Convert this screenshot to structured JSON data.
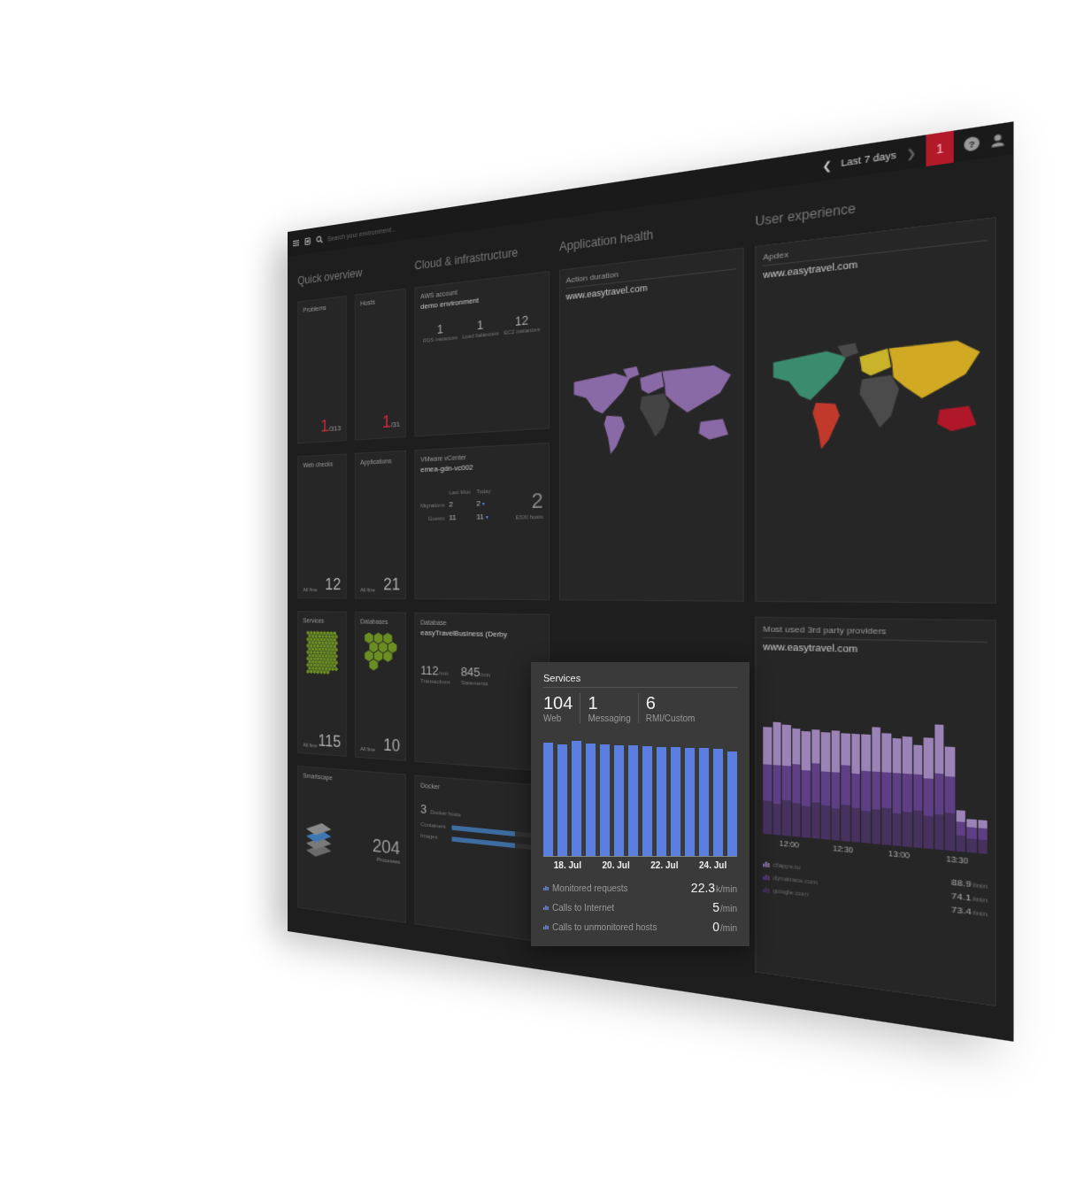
{
  "header": {
    "search_placeholder": "Search your environment...",
    "prev": "❮",
    "timeframe": "Last 7 days",
    "next": "❯",
    "problems_badge": "1",
    "help": "?"
  },
  "quick_overview": {
    "title": "Quick overview",
    "tiles": [
      {
        "kind": "ratio",
        "label": "Problems",
        "value": "1",
        "total": "/313"
      },
      {
        "kind": "ratio",
        "label": "Hosts",
        "value": "1",
        "total": "/31"
      },
      {
        "kind": "count",
        "label": "Web checks",
        "status": "All fine",
        "value": "12"
      },
      {
        "kind": "count",
        "label": "Applications",
        "status": "All fine",
        "value": "21"
      },
      {
        "kind": "hex",
        "label": "Services",
        "status": "All fine",
        "value": "115"
      },
      {
        "kind": "hex",
        "label": "Databases",
        "status": "All fine",
        "value": "10"
      }
    ],
    "smartscape": {
      "label": "Smartscape",
      "value": "204",
      "caption": "Processes"
    }
  },
  "cloud": {
    "title": "Cloud & infrastructure",
    "aws": {
      "label": "AWS account",
      "name": "demo environment",
      "stats": [
        {
          "value": "1",
          "label": "RDS instances"
        },
        {
          "value": "1",
          "label": "Load balancers"
        },
        {
          "value": "12",
          "label": "EC2 instances"
        }
      ]
    },
    "vmware": {
      "label": "VMware vCenter",
      "name": "emea-gdn-vc002",
      "columns": [
        "Last Mon",
        "Today"
      ],
      "rows": [
        {
          "label": "Migrations",
          "last": "2",
          "today": "2",
          "trend": "▾"
        },
        {
          "label": "Guests",
          "last": "11",
          "today": "11",
          "trend": "▾"
        }
      ],
      "hosts": "2",
      "hosts_label": "ESXi hosts"
    },
    "database": {
      "label": "Database",
      "name": "easyTravelBusiness (Derby",
      "stats": [
        {
          "value": "112",
          "unit": "/min",
          "label": "Transactions"
        },
        {
          "value": "845",
          "unit": "/min",
          "label": "Statements"
        }
      ]
    },
    "docker": {
      "label": "Docker",
      "hosts": "3",
      "hosts_label": "Docker hosts",
      "bars": [
        {
          "label": "Containers",
          "level": 0.7
        },
        {
          "label": "Images",
          "level": 0.7
        }
      ]
    }
  },
  "application_health": {
    "title": "Application health",
    "label": "Action duration",
    "site": "www.easytravel.com"
  },
  "user_experience": {
    "title": "User experience",
    "apdex": {
      "label": "Apdex",
      "site": "www.easytravel.com",
      "regions": [
        {
          "color": "#3b8c6e"
        },
        {
          "color": "#4a4a4a"
        },
        {
          "color": "#c0392b"
        },
        {
          "color": "#c9b32a"
        },
        {
          "color": "#4b4b4b"
        },
        {
          "color": "#d1a923"
        },
        {
          "color": "#b0182a"
        }
      ]
    },
    "providers": {
      "label": "Most used 3rd party providers",
      "site": "www.easytravel.com",
      "ticks": [
        "12:00",
        "12:30",
        "13:00",
        "13:30"
      ],
      "series": [
        {
          "name": "cfapps.io",
          "rate": "88.9",
          "unit": "/min",
          "color": "#9b83b8",
          "values": [
            30,
            34,
            32,
            28,
            30,
            26,
            30,
            32,
            24,
            30,
            28,
            34,
            30,
            26,
            28,
            22,
            30,
            36,
            22,
            8,
            6,
            6
          ]
        },
        {
          "name": "dynatrace.com",
          "rate": "74.1",
          "unit": "/min",
          "color": "#5e3f86",
          "values": [
            28,
            30,
            26,
            30,
            28,
            30,
            26,
            28,
            30,
            26,
            30,
            28,
            26,
            30,
            28,
            26,
            28,
            30,
            26,
            10,
            8,
            8
          ]
        },
        {
          "name": "google.com",
          "rate": "73.4",
          "unit": "/min",
          "color": "#46315f",
          "values": [
            26,
            24,
            28,
            26,
            24,
            28,
            26,
            24,
            28,
            26,
            24,
            26,
            28,
            24,
            26,
            28,
            24,
            26,
            28,
            12,
            10,
            10
          ]
        }
      ]
    }
  },
  "services_popup": {
    "title": "Services",
    "counts": [
      {
        "value": "104",
        "label": "Web"
      },
      {
        "value": "1",
        "label": "Messaging"
      },
      {
        "value": "6",
        "label": "RMI/Custom"
      }
    ],
    "values": [
      23.4,
      23.1,
      23.8,
      23.3,
      23.0,
      22.9,
      22.8,
      22.7,
      22.6,
      22.5,
      22.4,
      22.3,
      22.1,
      21.6
    ],
    "ticks": [
      "18. Jul",
      "20. Jul",
      "22. Jul",
      "24. Jul"
    ],
    "stats": [
      {
        "label": "Monitored requests",
        "value": "22.3",
        "unit": "k/min"
      },
      {
        "label": "Calls to Internet",
        "value": "5",
        "unit": "/min"
      },
      {
        "label": "Calls to unmonitored hosts",
        "value": "0",
        "unit": "/min"
      }
    ]
  }
}
